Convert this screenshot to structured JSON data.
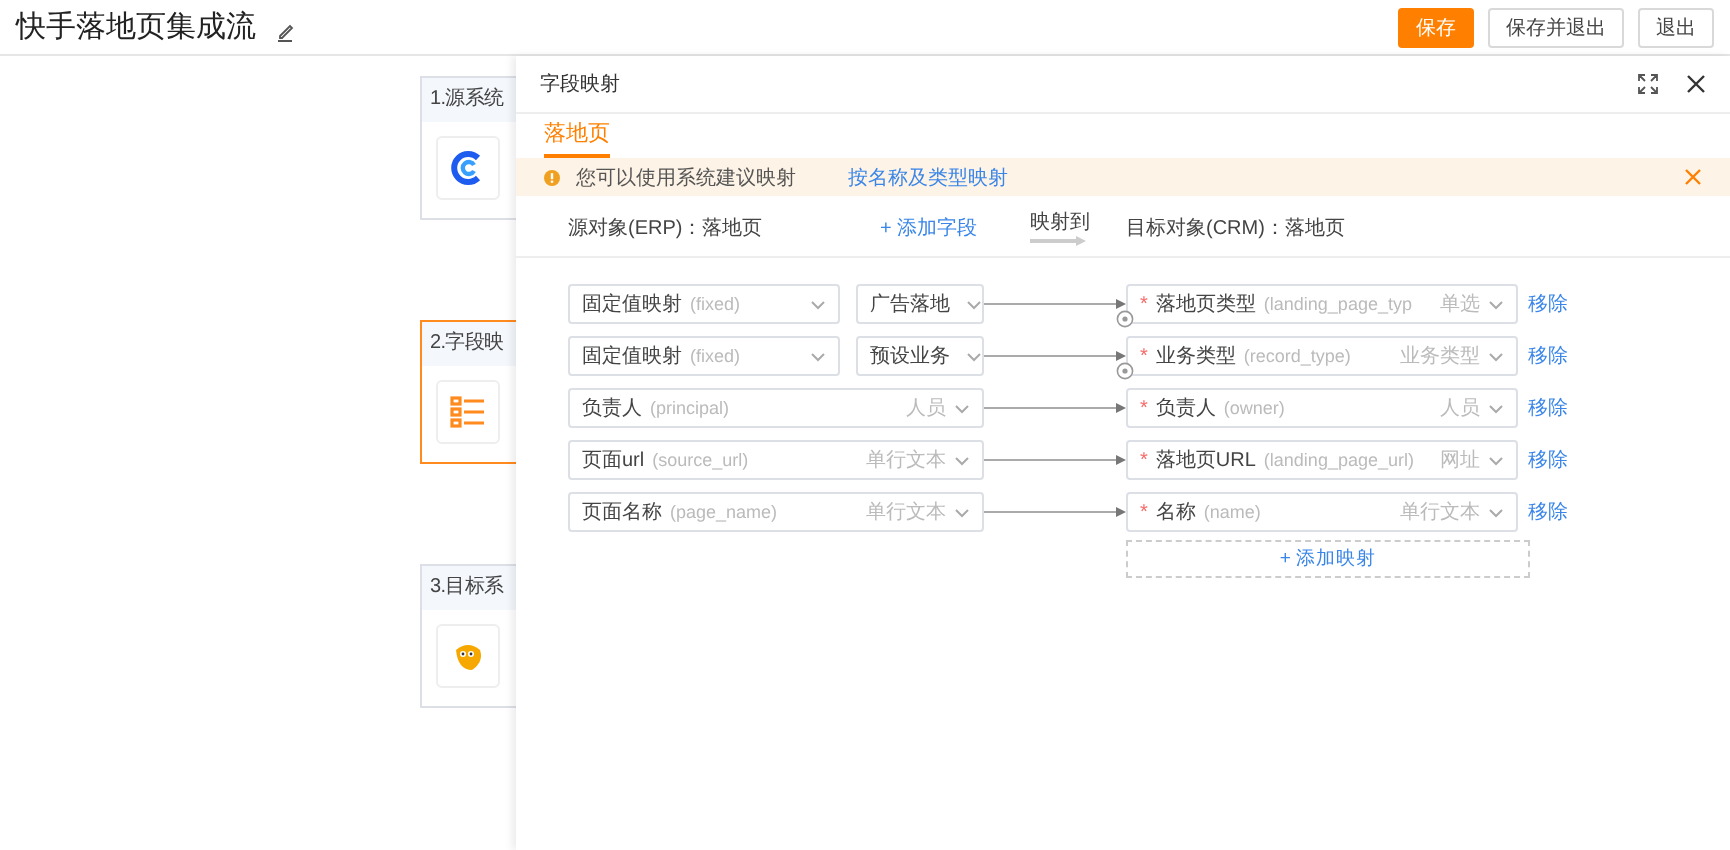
{
  "page": {
    "title": "快手落地页集成流"
  },
  "header_buttons": [
    {
      "label": "保存",
      "kind": "primary"
    },
    {
      "label": "保存并退出",
      "kind": "default"
    },
    {
      "label": "退出",
      "kind": "default"
    }
  ],
  "flow_steps": [
    {
      "title": "1.源系统",
      "selected": false,
      "kind": "source"
    },
    {
      "title": "2.字段映",
      "selected": true,
      "kind": "mapping"
    },
    {
      "title": "3.目标系",
      "selected": false,
      "kind": "target"
    }
  ],
  "drawer": {
    "title": "字段映射",
    "tabs": [
      {
        "label": "落地页",
        "selected": true
      }
    ],
    "alert": {
      "text": "您可以使用系统建议映射",
      "link": "按名称及类型映射"
    },
    "source_label": "源对象(ERP)：落地页",
    "add_field": "+ 添加字段",
    "map_to": "映射到",
    "target_label": "目标对象(CRM)：落地页",
    "rows": [
      {
        "kind": "fixed",
        "source": {
          "name": "固定值映射",
          "api": "(fixed)",
          "value": "广告落地"
        },
        "target": {
          "mark": "*",
          "name": "落地页类型",
          "api": "(landing_page_typ",
          "type": "单选"
        },
        "remove": "移除"
      },
      {
        "kind": "fixed",
        "source": {
          "name": "固定值映射",
          "api": "(fixed)",
          "value": "预设业务"
        },
        "target": {
          "mark": "*",
          "name": "业务类型",
          "api": "(record_type)",
          "type": "业务类型"
        },
        "remove": "移除"
      },
      {
        "kind": "field",
        "source": {
          "name": "负责人",
          "api": "(principal)",
          "type": "人员"
        },
        "target": {
          "mark": "*",
          "name": "负责人",
          "api": "(owner)",
          "type": "人员"
        },
        "remove": "移除"
      },
      {
        "kind": "field",
        "source": {
          "name": "页面url",
          "api": "(source_url)",
          "type": "单行文本"
        },
        "target": {
          "mark": "*",
          "name": "落地页URL",
          "api": "(landing_page_url)",
          "type": "网址"
        },
        "remove": "移除"
      },
      {
        "kind": "field",
        "source": {
          "name": "页面名称",
          "api": "(page_name)",
          "type": "单行文本"
        },
        "target": {
          "mark": "*",
          "name": "名称",
          "api": "(name)",
          "type": "单行文本"
        },
        "remove": "移除"
      }
    ],
    "add_mapping": "+ 添加映射"
  }
}
